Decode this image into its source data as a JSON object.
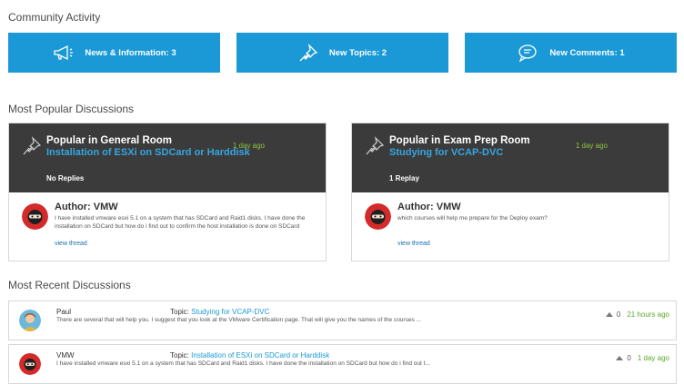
{
  "community_activity": {
    "title": "Community Activity",
    "buttons": [
      {
        "label": "News & Information: 3",
        "icon": "megaphone-icon"
      },
      {
        "label": "New Topics: 2",
        "icon": "pin-icon"
      },
      {
        "label": "New Comments: 1",
        "icon": "chat-bubble-icon"
      }
    ],
    "accent": "#1a99d6"
  },
  "popular": {
    "title": "Most Popular Discussions",
    "cards": [
      {
        "room": "Popular in General Room",
        "topic": "Installation of ESXi on SDCard or Harddisk",
        "ago": "1 day ago",
        "replies": "No Replies",
        "author": "Author: VMW",
        "excerpt": "I have installed vmware esxi 5.1 on a system that has SDCard and Raid1 disks. I have done the installation on SDCard but how do i find out to confirm the host installation is done on SDCard",
        "view": "view thread"
      },
      {
        "room": "Popular in Exam Prep Room",
        "topic": "Studying for VCAP-DVC",
        "ago": "1 day ago",
        "replies": "1 Replay",
        "author": "Author: VMW",
        "excerpt": "which courses will help me prepare for the Deploy exam?",
        "view": "view thread"
      }
    ]
  },
  "recent": {
    "title": "Most Recent Discussions",
    "topic_prefix": "Topic:",
    "rows": [
      {
        "user": "Paul",
        "topic": "Studying for VCAP-DVC",
        "body": "There are several that will help you. I suggest that you look at the VMware Certification page. That will give you the names of the courses ...",
        "votes": "0",
        "ago": "21 hours ago"
      },
      {
        "user": "VMW",
        "topic": "Installation of ESXi on SDCard or Harddisk",
        "body": "I have installed vmware esxi 5.1 on a system that has SDCard and Raid1 disks. I have done the installation on SDCard but how do i find out t...",
        "votes": "0",
        "ago": "1 day ago"
      }
    ]
  }
}
